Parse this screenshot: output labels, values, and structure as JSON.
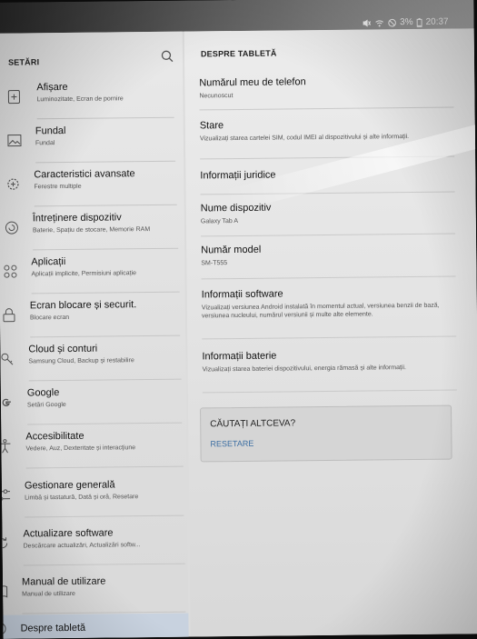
{
  "status_bar": {
    "battery": "3%",
    "time": "20:37",
    "icons": [
      "mute-icon",
      "wifi-icon",
      "blocked-icon",
      "battery-icon"
    ]
  },
  "left_pane": {
    "title": "SETĂRI",
    "search_icon": "search-icon",
    "items": [
      {
        "title": "Afișare",
        "subtitle": "Luminozitate, Ecran de pornire",
        "icon": "display-icon"
      },
      {
        "title": "Fundal",
        "subtitle": "Fundal",
        "icon": "wallpaper-icon"
      },
      {
        "title": "Caracteristici avansate",
        "subtitle": "Ferestre multiple",
        "icon": "gear-plus-icon"
      },
      {
        "title": "Întreținere dispozitiv",
        "subtitle": "Baterie, Spațiu de stocare, Memorie RAM",
        "icon": "device-care-icon"
      },
      {
        "title": "Aplicații",
        "subtitle": "Aplicații implicite, Permisiuni aplicație",
        "icon": "apps-icon"
      },
      {
        "title": "Ecran blocare și securit.",
        "subtitle": "Blocare ecran",
        "icon": "lock-icon"
      },
      {
        "title": "Cloud și conturi",
        "subtitle": "Samsung Cloud, Backup și restabilire",
        "icon": "key-icon"
      },
      {
        "title": "Google",
        "subtitle": "Setări Google",
        "icon": "google-icon"
      },
      {
        "title": "Accesibilitate",
        "subtitle": "Vedere, Auz, Dexteritate și interacțiune",
        "icon": "accessibility-icon"
      },
      {
        "title": "Gestionare generală",
        "subtitle": "Limbă și tastatură, Dată și oră, Resetare",
        "icon": "sliders-icon"
      },
      {
        "title": "Actualizare software",
        "subtitle": "Descărcare actualizări, Actualizări softw...",
        "icon": "update-icon"
      },
      {
        "title": "Manual de utilizare",
        "subtitle": "Manual de utilizare",
        "icon": "manual-icon"
      },
      {
        "title": "Despre tabletă",
        "subtitle": "",
        "icon": "info-icon"
      }
    ]
  },
  "right_pane": {
    "title": "DESPRE TABLETĂ",
    "items": [
      {
        "title": "Numărul meu de telefon",
        "subtitle": "Necunoscut"
      },
      {
        "title": "Stare",
        "subtitle": "Vizualizați starea cartelei SIM, codul IMEI al dispozitivului și alte informații."
      },
      {
        "title": "Informații juridice",
        "subtitle": ""
      },
      {
        "title": "Nume dispozitiv",
        "subtitle": "Galaxy Tab A"
      },
      {
        "title": "Număr model",
        "subtitle": "SM-T555"
      },
      {
        "title": "Informații software",
        "subtitle": "Vizualizați versiunea Android instalată în momentul actual, versiunea benzii de bază, versiunea nucleului, numărul versiunii și multe alte elemente."
      },
      {
        "title": "Informații baterie",
        "subtitle": "Vizualizați starea bateriei dispozitivului, energia rămasă și alte informații."
      }
    ],
    "search_card": {
      "heading": "CĂUTAȚI ALTCEVA?",
      "link": "RESETARE"
    }
  }
}
